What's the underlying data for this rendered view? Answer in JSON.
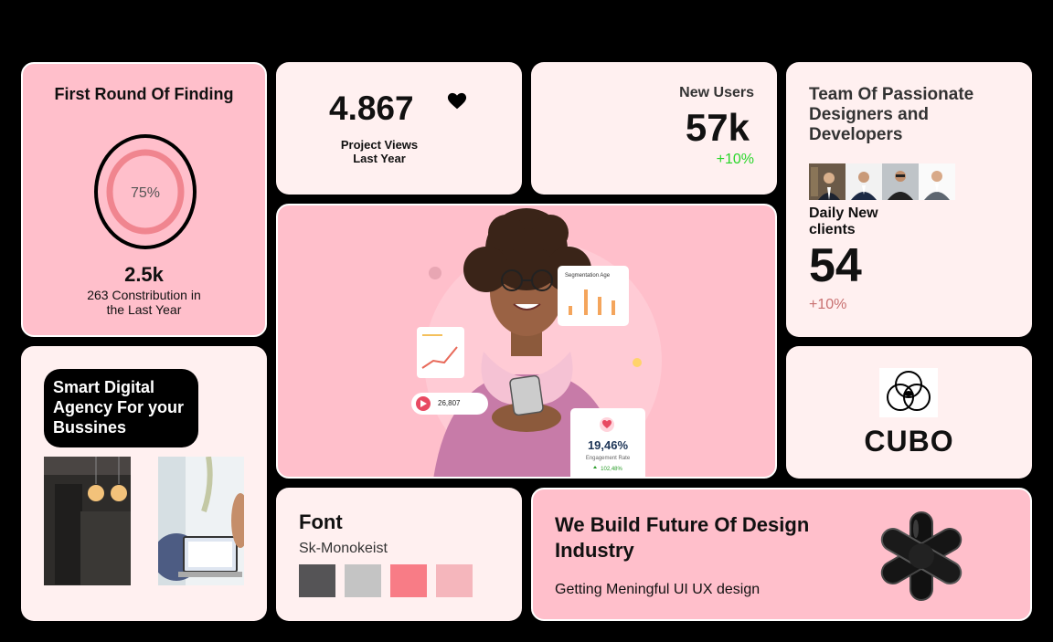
{
  "funding": {
    "title": "First Round Of Finding",
    "percent": "75%",
    "count": "2.5k",
    "subtitle": "263 Constribution in the Last Year"
  },
  "views": {
    "value": "4.867",
    "label": "Project Views Last Year",
    "icon": "heart-icon"
  },
  "users": {
    "label": "New Users",
    "value": "57k",
    "change": "+10%"
  },
  "team": {
    "title": "Team Of Passionate Designers and Developers",
    "daily_label": "Daily New clients",
    "value": "54",
    "change": "+10%"
  },
  "hero": {
    "chart_title": "Segmentation Age",
    "plays": "26,807",
    "engagement_value": "19,46%",
    "engagement_label": "Engagement Rate",
    "engagement_change": "102,48%"
  },
  "agency": {
    "title": "Smart Digital Agency For your Bussines"
  },
  "brand": {
    "name": "CUBO"
  },
  "font": {
    "title": "Font",
    "name": "Sk-Monokeist",
    "swatches": [
      "#555456",
      "#c4c4c4",
      "#f87c86",
      "#f5b6bc"
    ]
  },
  "future": {
    "title": "We Build Future Of Design Industry",
    "subtitle": "Getting Meningful UI UX design"
  },
  "colors": {
    "pink": "#ffbfcb",
    "light": "#fff0f0",
    "green": "#2ad62a"
  }
}
